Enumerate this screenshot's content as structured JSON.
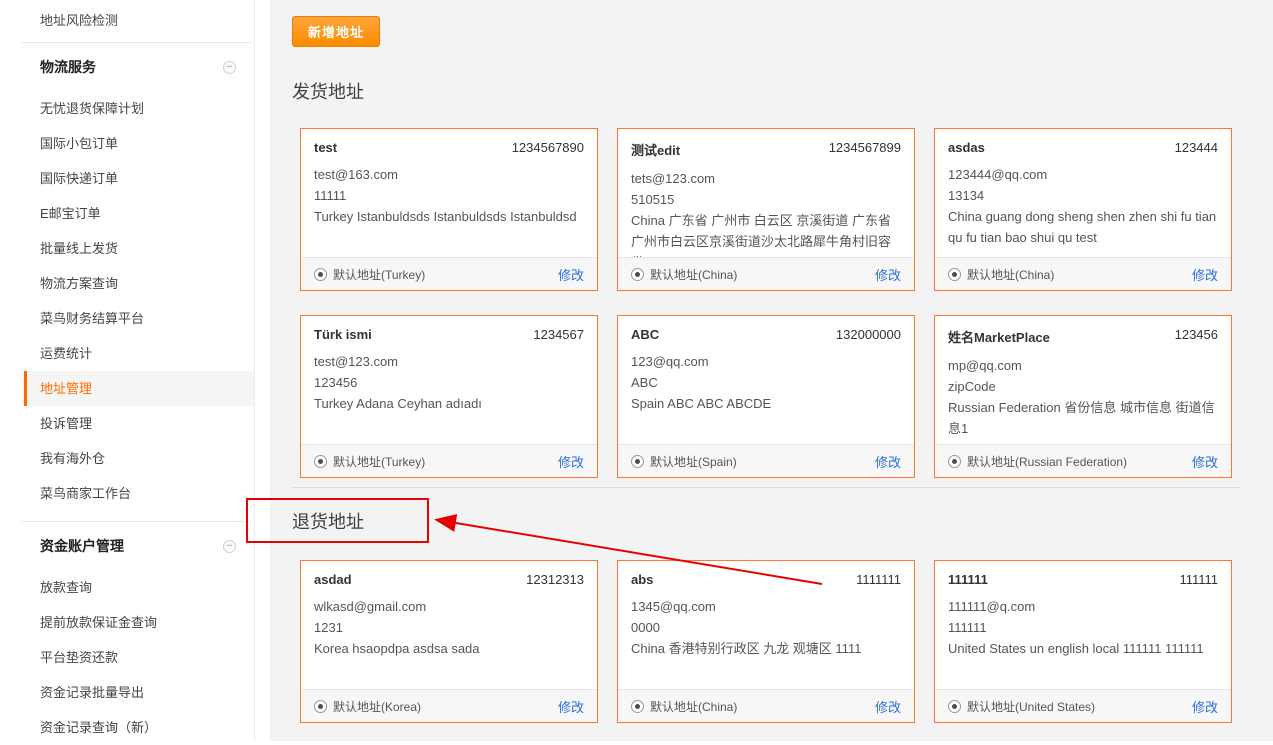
{
  "colors": {
    "accent_orange": "#ff6a00",
    "card_border": "#ff7534",
    "link_blue": "#2d6fdb",
    "annotation_red": "#e60000",
    "main_background": "#f3f3f3"
  },
  "icons": {
    "collapse_glyph": "−",
    "radio_state": "selected",
    "annotation": "red-box-and-arrow"
  },
  "sidebar": {
    "top_item": "地址风险检测",
    "sections": [
      {
        "title": "物流服务",
        "items": [
          "无忧退货保障计划",
          "国际小包订单",
          "国际快递订单",
          "E邮宝订单",
          "批量线上发货",
          "物流方案查询",
          "菜鸟财务结算平台",
          "运费统计",
          "地址管理",
          "投诉管理",
          "我有海外仓",
          "菜鸟商家工作台"
        ],
        "selected_item": "地址管理"
      },
      {
        "title": "资金账户管理",
        "items": [
          "放款查询",
          "提前放款保证金查询",
          "平台垫资还款",
          "资金记录批量导出",
          "资金记录查询（新）"
        ]
      }
    ]
  },
  "main": {
    "add_button_label": "新增地址",
    "shipping_title": "发货地址",
    "return_title": "退货地址",
    "modify_label": "修改",
    "shipping_addresses": [
      {
        "name": "test",
        "phone": "1234567890",
        "lines": [
          "test@163.com",
          "11111",
          "Turkey Istanbuldsds Istanbuldsds Istanbuldsd"
        ],
        "default_label": "默认地址(Turkey)"
      },
      {
        "name": "测试edit",
        "phone": "1234567899",
        "lines": [
          "tets@123.com",
          "510515",
          "China 广东省 广州市 白云区 京溪街道 广东省广州市白云区京溪街道沙太北路犀牛角村旧容发..."
        ],
        "default_label": "默认地址(China)"
      },
      {
        "name": "asdas",
        "phone": "123444",
        "lines": [
          "123444@qq.com",
          "13134",
          "China guang dong sheng shen zhen shi fu tian qu fu tian bao shui qu test"
        ],
        "default_label": "默认地址(China)"
      },
      {
        "name": "Türk ismi",
        "phone": "1234567",
        "lines": [
          "test@123.com",
          "123456",
          "Turkey Adana Ceyhan adıadı"
        ],
        "default_label": "默认地址(Turkey)"
      },
      {
        "name": "ABC",
        "phone": "132000000",
        "lines": [
          "123@qq.com",
          "ABC",
          "Spain ABC ABC ABCDE"
        ],
        "default_label": "默认地址(Spain)"
      },
      {
        "name": "姓名MarketPlace",
        "phone": "123456",
        "lines": [
          "mp@qq.com",
          "zipCode",
          "Russian Federation 省份信息 城市信息 街道信息1"
        ],
        "default_label": "默认地址(Russian Federation)"
      }
    ],
    "return_addresses": [
      {
        "name": "asdad",
        "phone": "12312313",
        "lines": [
          "wlkasd@gmail.com",
          "1231",
          "Korea hsaopdpa asdsa sada"
        ],
        "default_label": "默认地址(Korea)"
      },
      {
        "name": "abs",
        "phone": "1111111",
        "lines": [
          "1345@qq.com",
          "0000",
          "China 香港特别行政区 九龙 观塘区 1111"
        ],
        "default_label": "默认地址(China)"
      },
      {
        "name": "111111",
        "phone": "111111",
        "lines": [
          "111111@q.com",
          "111111",
          "United States un english local 111111 111111"
        ],
        "default_label": "默认地址(United States)"
      }
    ]
  }
}
